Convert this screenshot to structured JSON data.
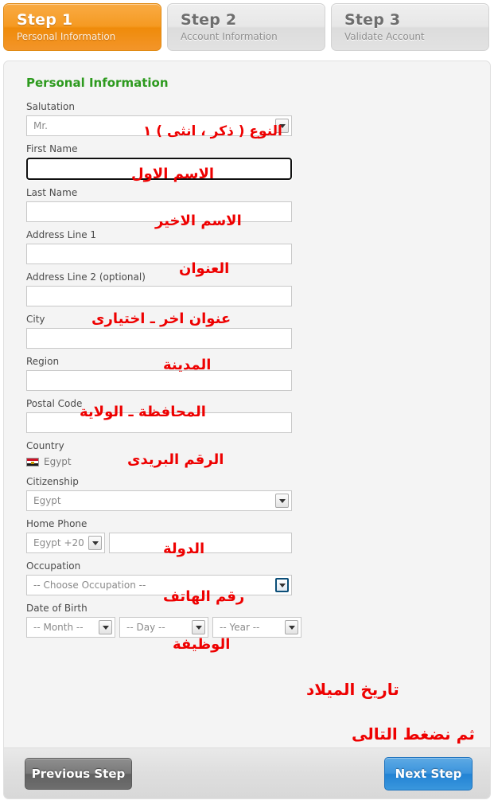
{
  "steps": [
    {
      "title": "Step 1",
      "subtitle": "Personal Information",
      "state": "active"
    },
    {
      "title": "Step 2",
      "subtitle": "Account Information",
      "state": "inactive"
    },
    {
      "title": "Step 3",
      "subtitle": "Validate Account",
      "state": "inactive"
    }
  ],
  "form": {
    "section_title": "Personal Information",
    "salutation": {
      "label": "Salutation",
      "value": "Mr."
    },
    "first_name": {
      "label": "First Name",
      "value": ""
    },
    "last_name": {
      "label": "Last Name",
      "value": ""
    },
    "address1": {
      "label": "Address Line 1",
      "value": ""
    },
    "address2": {
      "label": "Address Line 2 (optional)",
      "value": ""
    },
    "city": {
      "label": "City",
      "value": ""
    },
    "region": {
      "label": "Region",
      "value": ""
    },
    "postal_code": {
      "label": "Postal Code",
      "value": ""
    },
    "country": {
      "label": "Country",
      "value": "Egypt",
      "flag": "egypt-flag-icon"
    },
    "citizenship": {
      "label": "Citizenship",
      "value": "Egypt"
    },
    "home_phone": {
      "label": "Home Phone",
      "country_code": "Egypt +20",
      "number": ""
    },
    "occupation": {
      "label": "Occupation",
      "value": "-- Choose Occupation --"
    },
    "date_of_birth": {
      "label": "Date of Birth",
      "month": "-- Month --",
      "day": "-- Day --",
      "year": "-- Year --"
    }
  },
  "annotations": {
    "salutation": "النوع ( ذكر ، انثى ) ١",
    "first_name": "الاسم الاول",
    "last_name": "الاسم الاخير",
    "address1": "العنوان",
    "address2": "عنوان اخر ـ اختيارى",
    "city": "المدينة",
    "region": "المحافظة ـ الولاية",
    "postal_code": "الرقم البريدى",
    "citizenship": "الدولة",
    "home_phone": "رقم الهاتف",
    "occupation": "الوظيفة",
    "date_of_birth": "تاريخ الميلاد",
    "next_step": "ثم نضغط التالى"
  },
  "footer": {
    "previous_label": "Previous Step",
    "next_label": "Next Step"
  },
  "colors": {
    "active_step": "#f29422",
    "section_title": "#2d9a1e",
    "annotation": "#ee0000",
    "next_button": "#2283d4",
    "focus_border": "#4c9a2a"
  }
}
